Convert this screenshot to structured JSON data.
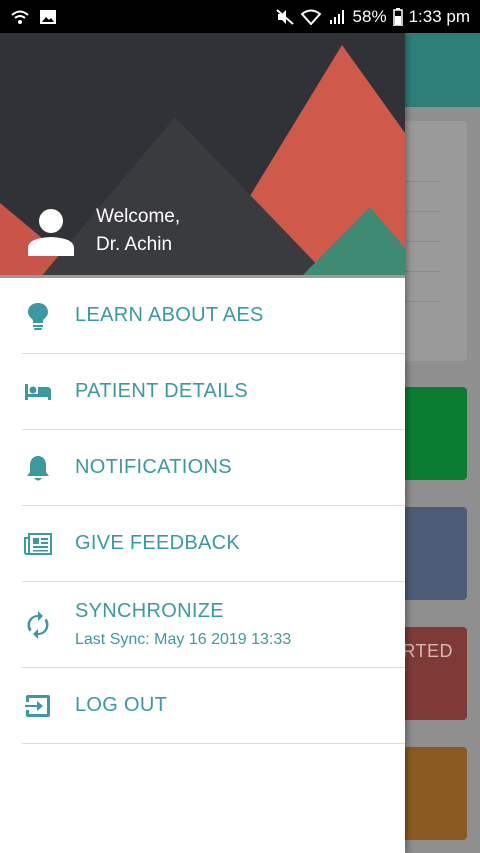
{
  "status_bar": {
    "battery": "58%",
    "time": "1:33 pm",
    "icons": [
      "wifi-call-icon",
      "image-icon",
      "mute-icon",
      "wifi-icon",
      "signal-icon",
      "battery-icon"
    ]
  },
  "drawer": {
    "welcome_line1": "Welcome,",
    "welcome_line2": "Dr. Achin",
    "items": [
      {
        "label": "LEARN ABOUT AES",
        "icon": "lightbulb-icon"
      },
      {
        "label": "PATIENT DETAILS",
        "icon": "bed-icon"
      },
      {
        "label": "NOTIFICATIONS",
        "icon": "bell-icon"
      },
      {
        "label": "GIVE FEEDBACK",
        "icon": "newspaper-icon"
      },
      {
        "label": "SYNCHRONIZE",
        "sublabel": "Last Sync: May 16 2019 13:33",
        "icon": "sync-icon"
      },
      {
        "label": "LOG OUT",
        "icon": "logout-icon"
      }
    ]
  },
  "background": {
    "tile_partial_text": "RTED"
  },
  "colors": {
    "accent": "#3a9aa0",
    "header_dark": "#2f3337",
    "header_red": "#cf5a4b",
    "header_green": "#3f8a72",
    "appbar": "#2e7f78"
  }
}
